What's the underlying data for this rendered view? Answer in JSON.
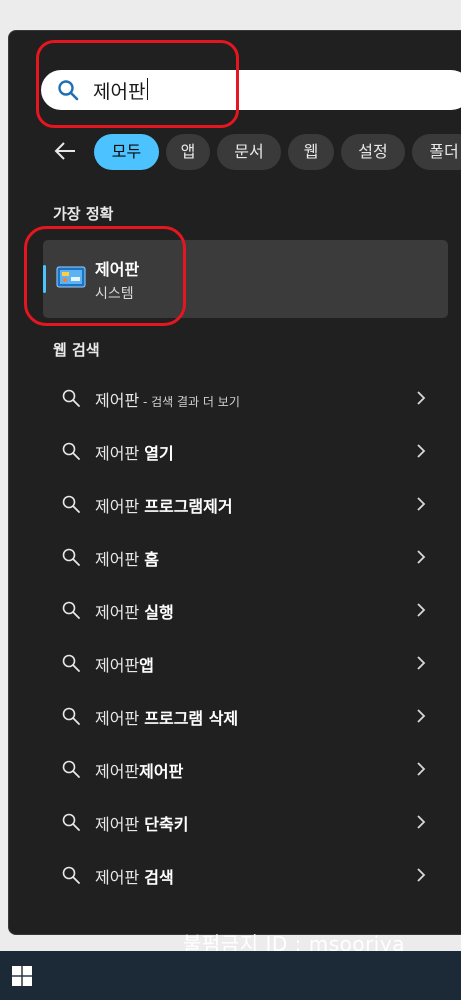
{
  "search": {
    "value": "제어판",
    "placeholder": ""
  },
  "filters": [
    {
      "label": "모두",
      "active": true
    },
    {
      "label": "앱"
    },
    {
      "label": "문서"
    },
    {
      "label": "웹"
    },
    {
      "label": "설정"
    },
    {
      "label": "폴더"
    }
  ],
  "best_match": {
    "title": "가장 정확",
    "name": "제어판",
    "type": "시스템"
  },
  "web": {
    "title": "웹 검색",
    "results": [
      {
        "prefix": "제어판",
        "suffix": "",
        "extra": " - 검색 결과 더 보기"
      },
      {
        "prefix": "제어판 ",
        "suffix": "열기"
      },
      {
        "prefix": "제어판 ",
        "suffix": "프로그램제거"
      },
      {
        "prefix": "제어판 ",
        "suffix": "홈"
      },
      {
        "prefix": "제어판 ",
        "suffix": "실행"
      },
      {
        "prefix": "제어판",
        "suffix": "앱"
      },
      {
        "prefix": "제어판 ",
        "suffix": "프로그램 삭제"
      },
      {
        "prefix": "제어판",
        "suffix": "제어판"
      },
      {
        "prefix": "제어판 ",
        "suffix": "단축키"
      },
      {
        "prefix": "제어판 ",
        "suffix": "검색"
      }
    ]
  },
  "watermark": "불펌금지 ID : msooriya",
  "colors": {
    "accent": "#4cc2ff",
    "panel": "#202020",
    "annotation": "#e5161f"
  }
}
